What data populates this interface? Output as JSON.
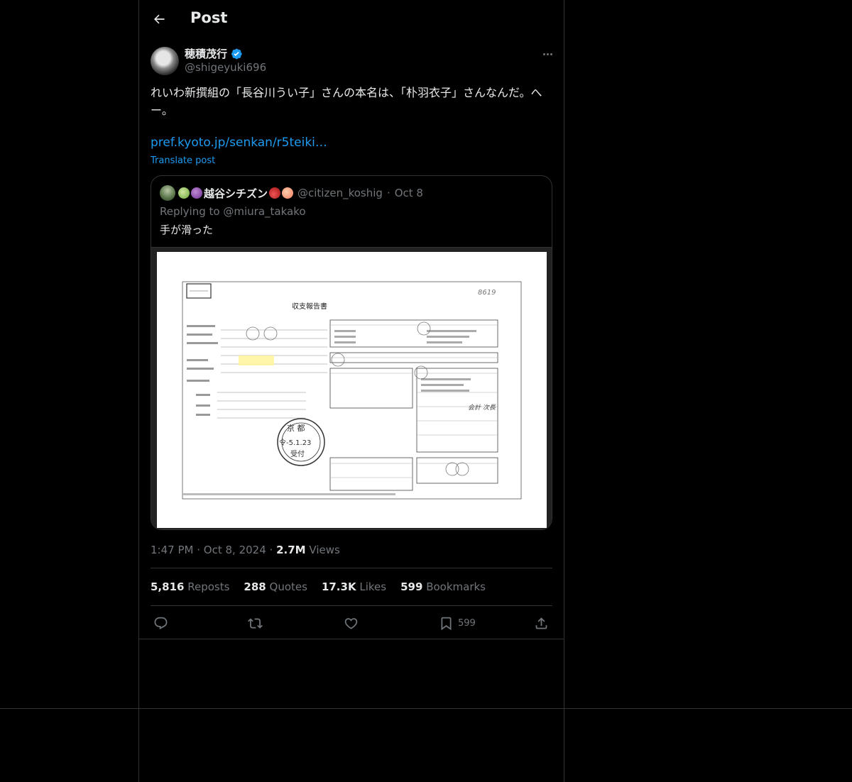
{
  "header": {
    "title": "Post"
  },
  "author": {
    "name": "穂積茂行",
    "handle": "@shigeyuki696"
  },
  "post": {
    "text": "れいわ新撰組の「長谷川うい子」さんの本名は、「朴羽衣子」さんなんだ。へー。",
    "link": "pref.kyoto.jp/senkan/r5teiki…",
    "translate": "Translate post"
  },
  "quote": {
    "name": "越谷シチズン",
    "handle": "@citizen_koshig",
    "separator": "·",
    "date": "Oct 8",
    "replying_prefix": "Replying to",
    "replying_handle": "@miura_takako",
    "text": "手が滑った"
  },
  "meta": {
    "time": "1:47 PM",
    "date": "Oct 8, 2024",
    "sep": "·",
    "views_count": "2.7M",
    "views_label": "Views"
  },
  "stats": {
    "reposts_count": "5,816",
    "reposts_label": "Reposts",
    "quotes_count": "288",
    "quotes_label": "Quotes",
    "likes_count": "17.3K",
    "likes_label": "Likes",
    "bookmarks_count": "599",
    "bookmarks_label": "Bookmarks"
  },
  "actions": {
    "bookmark_count": "599"
  },
  "document": {
    "title": "収支報告書",
    "stamp_top": "京 都",
    "stamp_date": "令-5.1.23",
    "stamp_recv": "受付"
  },
  "colors": {
    "accent": "#1d9bf0",
    "muted": "#71767b",
    "text": "#e7e9ea",
    "border": "#2f3336",
    "background": "#000000"
  },
  "icons": [
    "back-arrow-icon",
    "verified-badge-icon",
    "more-icon",
    "reply-icon",
    "repost-icon",
    "like-icon",
    "bookmark-icon",
    "share-icon"
  ]
}
